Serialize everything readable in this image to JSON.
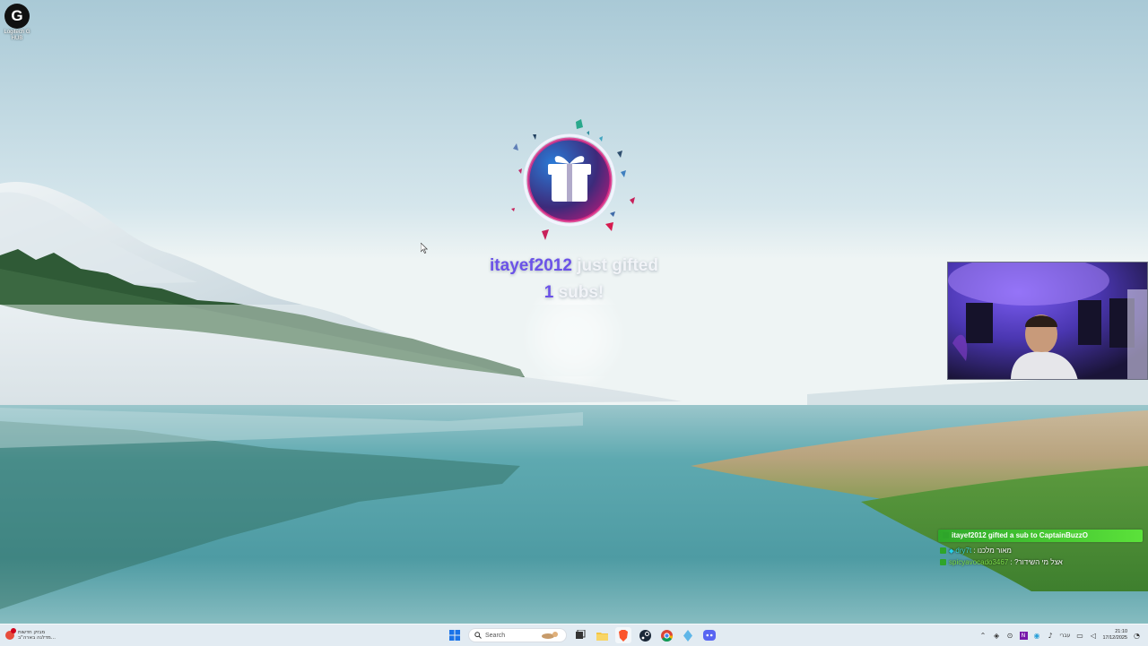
{
  "desktop": {
    "icons": [
      {
        "name": "Logitech G HUB",
        "label": "Logitech G HUB"
      }
    ]
  },
  "alert": {
    "username": "itayef2012",
    "action": "just gifted",
    "count": "1",
    "unit": "subs!",
    "accent_color": "#6b52e8"
  },
  "chat": {
    "banner": "itayef2012 gifted a sub to CaptainBuzzO",
    "messages": [
      {
        "user": "dry7t",
        "text": "מאור מלכנו"
      },
      {
        "user": "spicyavocado3467",
        "text": "?אצל מי השידור"
      }
    ]
  },
  "taskbar": {
    "weather": {
      "line1": "מבזק חדשות",
      "line2": "מדלגה בארה\"ב..."
    },
    "search_placeholder": "Search",
    "pinned_icons": [
      "widget-icon",
      "task-view-icon",
      "file-explorer-icon",
      "brave-icon",
      "steam-icon",
      "chrome-icon",
      "app-icon",
      "discord-icon"
    ],
    "tray": {
      "language": "עברי",
      "time": "21:10",
      "date": "17/12/2025"
    }
  }
}
